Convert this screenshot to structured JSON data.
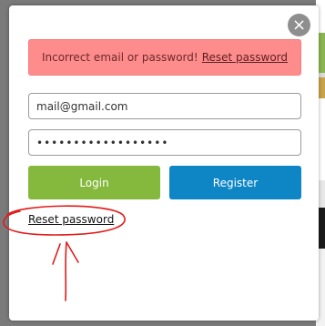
{
  "alert": {
    "message": "Incorrect email or password!",
    "link_label": "Reset password",
    "background_color": "#ff8c8c"
  },
  "close": {
    "icon": "close-icon",
    "glyph": "×"
  },
  "form": {
    "email_value": "mail@gmail.com",
    "password_value": "••••••••••••••••••"
  },
  "buttons": {
    "login_label": "Login",
    "register_label": "Register",
    "login_color": "#85b93e",
    "register_color": "#0e86c6"
  },
  "reset_link": {
    "label": "Reset password"
  },
  "annotation": {
    "color": "#e21b1b",
    "shapes": [
      "ellipse",
      "arrow"
    ]
  }
}
